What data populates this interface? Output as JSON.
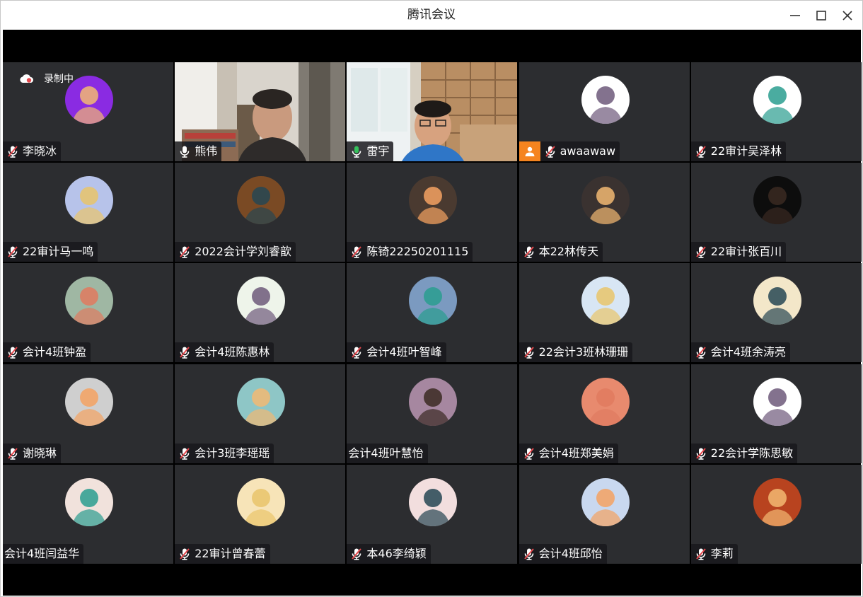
{
  "window": {
    "title": "腾讯会议"
  },
  "recording": {
    "label": "录制中"
  },
  "colors": {
    "speaking_green": "#35c25c",
    "host_orange": "#f5841f",
    "tile_bg": "#2c2d30",
    "muted_red": "#e5484d"
  },
  "participants": [
    {
      "name": "李晓冰",
      "mic": "muted",
      "avatar_kind": "avatar",
      "avatar_color": "#8a2be2"
    },
    {
      "name": "熊伟",
      "mic": "on",
      "avatar_kind": "video"
    },
    {
      "name": "雷宇",
      "mic": "speaking",
      "avatar_kind": "video"
    },
    {
      "name": "awaawaw",
      "mic": "muted",
      "host": true,
      "avatar_kind": "avatar",
      "avatar_color": "#ffffff"
    },
    {
      "name": "22审计吴泽林",
      "mic": "muted",
      "avatar_kind": "avatar",
      "avatar_color": "#ffffff"
    },
    {
      "name": "22审计马一鸣",
      "mic": "muted",
      "avatar_kind": "avatar",
      "avatar_color": "#b7c3ea"
    },
    {
      "name": "2022会计学刘睿歆",
      "mic": "muted",
      "avatar_kind": "avatar",
      "avatar_color": "#7a4a24"
    },
    {
      "name": "陈锜22250201115",
      "mic": "muted",
      "avatar_kind": "avatar",
      "avatar_color": "#4a3a30"
    },
    {
      "name": "本22林传天",
      "mic": "muted",
      "avatar_kind": "avatar",
      "avatar_color": "#3a3230"
    },
    {
      "name": "22审计张百川",
      "mic": "muted",
      "avatar_kind": "avatar",
      "avatar_color": "#0d0d0d"
    },
    {
      "name": "会计4班钟盈",
      "mic": "muted",
      "avatar_kind": "avatar",
      "avatar_color": "#9fb7a3"
    },
    {
      "name": "会计4班陈惠林",
      "mic": "muted",
      "avatar_kind": "avatar",
      "avatar_color": "#eef4ea"
    },
    {
      "name": "会计4班叶智峰",
      "mic": "muted",
      "avatar_kind": "avatar",
      "avatar_color": "#7b9ac0"
    },
    {
      "name": "22会计3班林珊珊",
      "mic": "muted",
      "avatar_kind": "avatar",
      "avatar_color": "#d8e6f4"
    },
    {
      "name": "会计4班余涛亮",
      "mic": "muted",
      "avatar_kind": "avatar",
      "avatar_color": "#f3e7c9"
    },
    {
      "name": "谢晓琳",
      "mic": "muted",
      "avatar_kind": "avatar",
      "avatar_color": "#cfcfcf"
    },
    {
      "name": "会计3班李瑶瑶",
      "mic": "muted",
      "avatar_kind": "avatar",
      "avatar_color": "#8ec6c6"
    },
    {
      "name": "会计4班叶慧怡",
      "mic": "none",
      "avatar_kind": "avatar",
      "avatar_color": "#a687a0"
    },
    {
      "name": "会计4班郑美娟",
      "mic": "muted",
      "avatar_kind": "avatar",
      "avatar_color": "#e88a6e"
    },
    {
      "name": "22会计学陈思敏",
      "mic": "muted",
      "avatar_kind": "avatar",
      "avatar_color": "#ffffff"
    },
    {
      "name": "会计4班闫益华",
      "mic": "none",
      "avatar_kind": "avatar",
      "avatar_color": "#f1e2dc"
    },
    {
      "name": "22审计曾春蕾",
      "mic": "muted",
      "avatar_kind": "avatar",
      "avatar_color": "#f7e4b8"
    },
    {
      "name": "本46李绮颖",
      "mic": "muted",
      "avatar_kind": "avatar",
      "avatar_color": "#f2dede"
    },
    {
      "name": "会计4班邱怡",
      "mic": "muted",
      "avatar_kind": "avatar",
      "avatar_color": "#c9d8ef"
    },
    {
      "name": "李莉",
      "mic": "muted",
      "avatar_kind": "avatar",
      "avatar_color": "#b8431f"
    }
  ]
}
